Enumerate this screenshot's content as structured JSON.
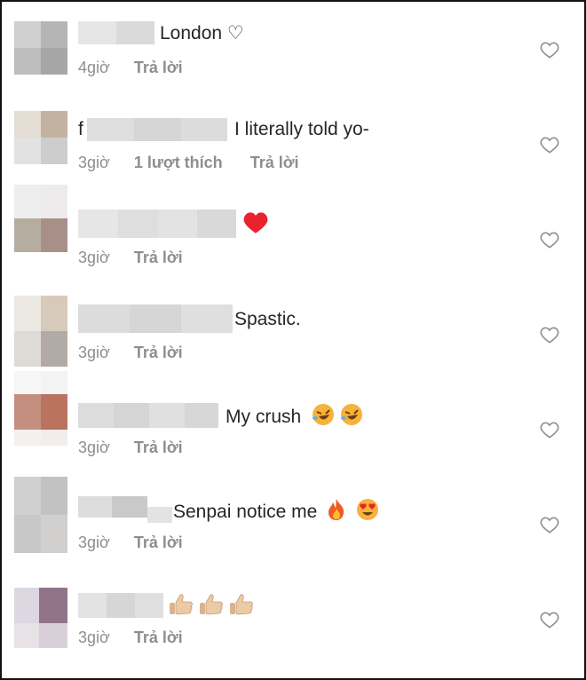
{
  "comments": [
    {
      "text": "London ♡",
      "time": "4giờ",
      "likes": "",
      "reply": "Trả lời",
      "like_icon": "heart-outline-icon"
    },
    {
      "text": "I literally told yo-",
      "time": "3giờ",
      "likes": "1 lượt thích",
      "reply": "Trả lời",
      "like_icon": "heart-outline-icon"
    },
    {
      "text": "",
      "time": "3giờ",
      "likes": "",
      "reply": "Trả lời",
      "emojis": [
        "red-heart-emoji"
      ],
      "like_icon": "heart-outline-icon"
    },
    {
      "text": "Spastic.",
      "time": "3giờ",
      "likes": "",
      "reply": "Trả lời",
      "like_icon": "heart-outline-icon"
    },
    {
      "text": "My crush",
      "time": "3giờ",
      "likes": "",
      "reply": "Trả lời",
      "emojis": [
        "rofl-emoji",
        "rofl-emoji"
      ],
      "like_icon": "heart-outline-icon"
    },
    {
      "text": "Senpai notice me",
      "time": "3giờ",
      "likes": "",
      "reply": "Trả lời",
      "emojis": [
        "fire-emoji",
        "heart-eyes-emoji"
      ],
      "like_icon": "heart-outline-icon"
    },
    {
      "text": "",
      "time": "3giờ",
      "likes": "",
      "reply": "Trả lời",
      "emojis": [
        "thumbs-up-emoji",
        "thumbs-up-emoji",
        "thumbs-up-emoji"
      ],
      "like_icon": "heart-outline-icon"
    }
  ],
  "colors": {
    "text": "#262626",
    "meta": "#8e8e8e",
    "heart_outline": "#8e8e8e",
    "red_heart": "#e8232f"
  }
}
